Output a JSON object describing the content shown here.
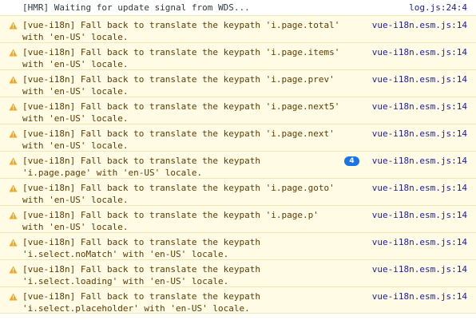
{
  "console": {
    "entries": [
      {
        "level": "log",
        "message": "[HMR] Waiting for update signal from WDS...",
        "source": "log.js:24:4"
      },
      {
        "level": "warning",
        "icon": "warning-icon",
        "message": "[vue-i18n] Fall back to translate the keypath 'i.page.total'\nwith 'en-US' locale.",
        "source": "vue-i18n.esm.js:14"
      },
      {
        "level": "warning",
        "icon": "warning-icon",
        "message": "[vue-i18n] Fall back to translate the keypath 'i.page.items'\nwith 'en-US' locale.",
        "source": "vue-i18n.esm.js:14"
      },
      {
        "level": "warning",
        "icon": "warning-icon",
        "message": "[vue-i18n] Fall back to translate the keypath 'i.page.prev'\nwith 'en-US' locale.",
        "source": "vue-i18n.esm.js:14"
      },
      {
        "level": "warning",
        "icon": "warning-icon",
        "message": "[vue-i18n] Fall back to translate the keypath 'i.page.next5'\nwith 'en-US' locale.",
        "source": "vue-i18n.esm.js:14"
      },
      {
        "level": "warning",
        "icon": "warning-icon",
        "message": "[vue-i18n] Fall back to translate the keypath 'i.page.next'\nwith 'en-US' locale.",
        "source": "vue-i18n.esm.js:14"
      },
      {
        "level": "warning",
        "icon": "warning-icon",
        "message": "[vue-i18n] Fall back to translate the keypath\n'i.page.page' with 'en-US' locale.",
        "source": "vue-i18n.esm.js:14",
        "repeat_count": "4"
      },
      {
        "level": "warning",
        "icon": "warning-icon",
        "message": "[vue-i18n] Fall back to translate the keypath 'i.page.goto'\nwith 'en-US' locale.",
        "source": "vue-i18n.esm.js:14"
      },
      {
        "level": "warning",
        "icon": "warning-icon",
        "message": "[vue-i18n] Fall back to translate the keypath 'i.page.p'\nwith 'en-US' locale.",
        "source": "vue-i18n.esm.js:14"
      },
      {
        "level": "warning",
        "icon": "warning-icon",
        "message": "[vue-i18n] Fall back to translate the keypath\n'i.select.noMatch' with 'en-US' locale.",
        "source": "vue-i18n.esm.js:14"
      },
      {
        "level": "warning",
        "icon": "warning-icon",
        "message": "[vue-i18n] Fall back to translate the keypath\n'i.select.loading' with 'en-US' locale.",
        "source": "vue-i18n.esm.js:14"
      },
      {
        "level": "warning",
        "icon": "warning-icon",
        "message": "[vue-i18n] Fall back to translate the keypath\n'i.select.placeholder' with 'en-US' locale.",
        "source": "vue-i18n.esm.js:14"
      }
    ]
  },
  "colors": {
    "warning_background": "#fffbe5",
    "warning_text": "#5c3b00",
    "warning_icon": "#f4a71b",
    "source_link": "#1a1aa6",
    "badge": "#1a73e8"
  }
}
